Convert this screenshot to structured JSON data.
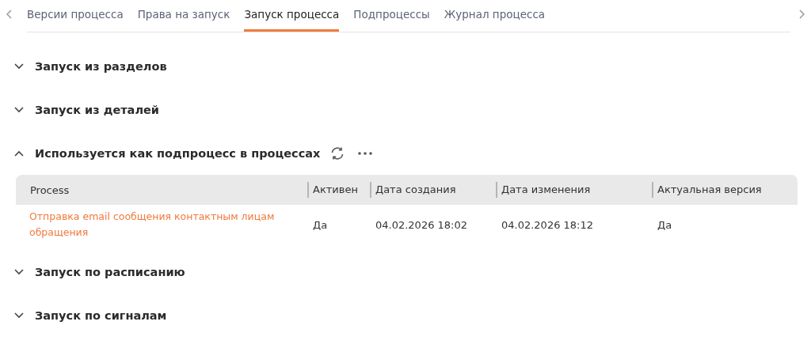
{
  "tabs": [
    {
      "label": "Версии процесса",
      "selected": false
    },
    {
      "label": "Права на запуск",
      "selected": false
    },
    {
      "label": "Запуск процесса",
      "selected": true
    },
    {
      "label": "Подпроцессы",
      "selected": false
    },
    {
      "label": "Журнал процесса",
      "selected": false
    }
  ],
  "sections": [
    {
      "title": "Запуск из разделов",
      "expanded": false
    },
    {
      "title": "Запуск из деталей",
      "expanded": false
    },
    {
      "title": "Используется как подпроцесс в процессах",
      "expanded": true,
      "table": {
        "columns": [
          "Process",
          "Активен",
          "Дата создания",
          "Дата изменения",
          "Актуальная версия"
        ],
        "rows": [
          [
            "Отправка email сообщения контактным лицам обращения",
            "Да",
            "04.02.2026 18:02",
            "04.02.2026 18:12",
            "Да"
          ]
        ]
      }
    },
    {
      "title": "Запуск по расписанию",
      "expanded": false
    },
    {
      "title": "Запуск по сигналам",
      "expanded": false
    }
  ]
}
